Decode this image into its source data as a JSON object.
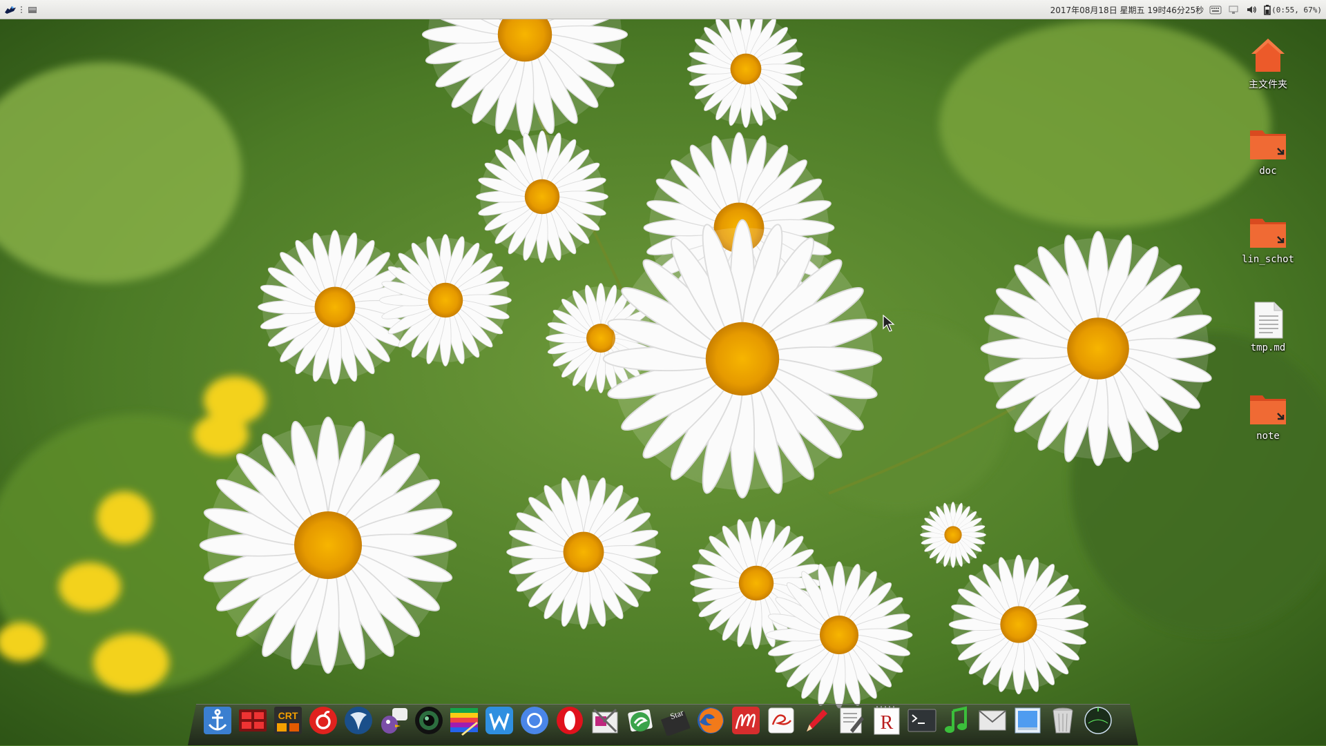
{
  "top_panel": {
    "datetime": "2017年08月18日  星期五  19时46分25秒",
    "battery_status": "(0:55, 67%)"
  },
  "desktop_icons": [
    {
      "label": "主文件夹",
      "icon": "home-folder-icon"
    },
    {
      "label": "doc",
      "icon": "folder-link-icon"
    },
    {
      "label": "lin_schot",
      "icon": "folder-link-icon"
    },
    {
      "label": "tmp.md",
      "icon": "text-file-icon"
    },
    {
      "label": "note",
      "icon": "folder-link-icon"
    }
  ],
  "dock": {
    "items": [
      {
        "icon": "anchor-icon"
      },
      {
        "icon": "red-grid-app-icon"
      },
      {
        "icon": "securecrt-icon"
      },
      {
        "icon": "netease-music-icon"
      },
      {
        "icon": "wireshark-icon"
      },
      {
        "icon": "pidgin-icon"
      },
      {
        "icon": "camera-lens-icon"
      },
      {
        "icon": "color-palette-icon"
      },
      {
        "icon": "wps-writer-icon"
      },
      {
        "icon": "chromium-icon"
      },
      {
        "icon": "opera-icon"
      },
      {
        "icon": "screenshot-tool-icon"
      },
      {
        "icon": "evolution-icon"
      },
      {
        "icon": "stardict-icon"
      },
      {
        "icon": "firefox-icon"
      },
      {
        "icon": "markdown-editor-icon"
      },
      {
        "icon": "signature-editor-icon"
      },
      {
        "icon": "pen-tool-icon"
      },
      {
        "icon": "text-editor-icon"
      },
      {
        "icon": "rstudio-icon"
      },
      {
        "icon": "terminal-icon"
      },
      {
        "icon": "music-player-icon"
      },
      {
        "icon": "mail-icon"
      },
      {
        "icon": "file-manager-icon"
      },
      {
        "icon": "trash-icon"
      },
      {
        "icon": "system-monitor-icon"
      }
    ]
  },
  "colors": {
    "panel_bg": "#ebebe8",
    "folder_orange": "#e8572a",
    "dock_blue": "#2f8fe0"
  }
}
